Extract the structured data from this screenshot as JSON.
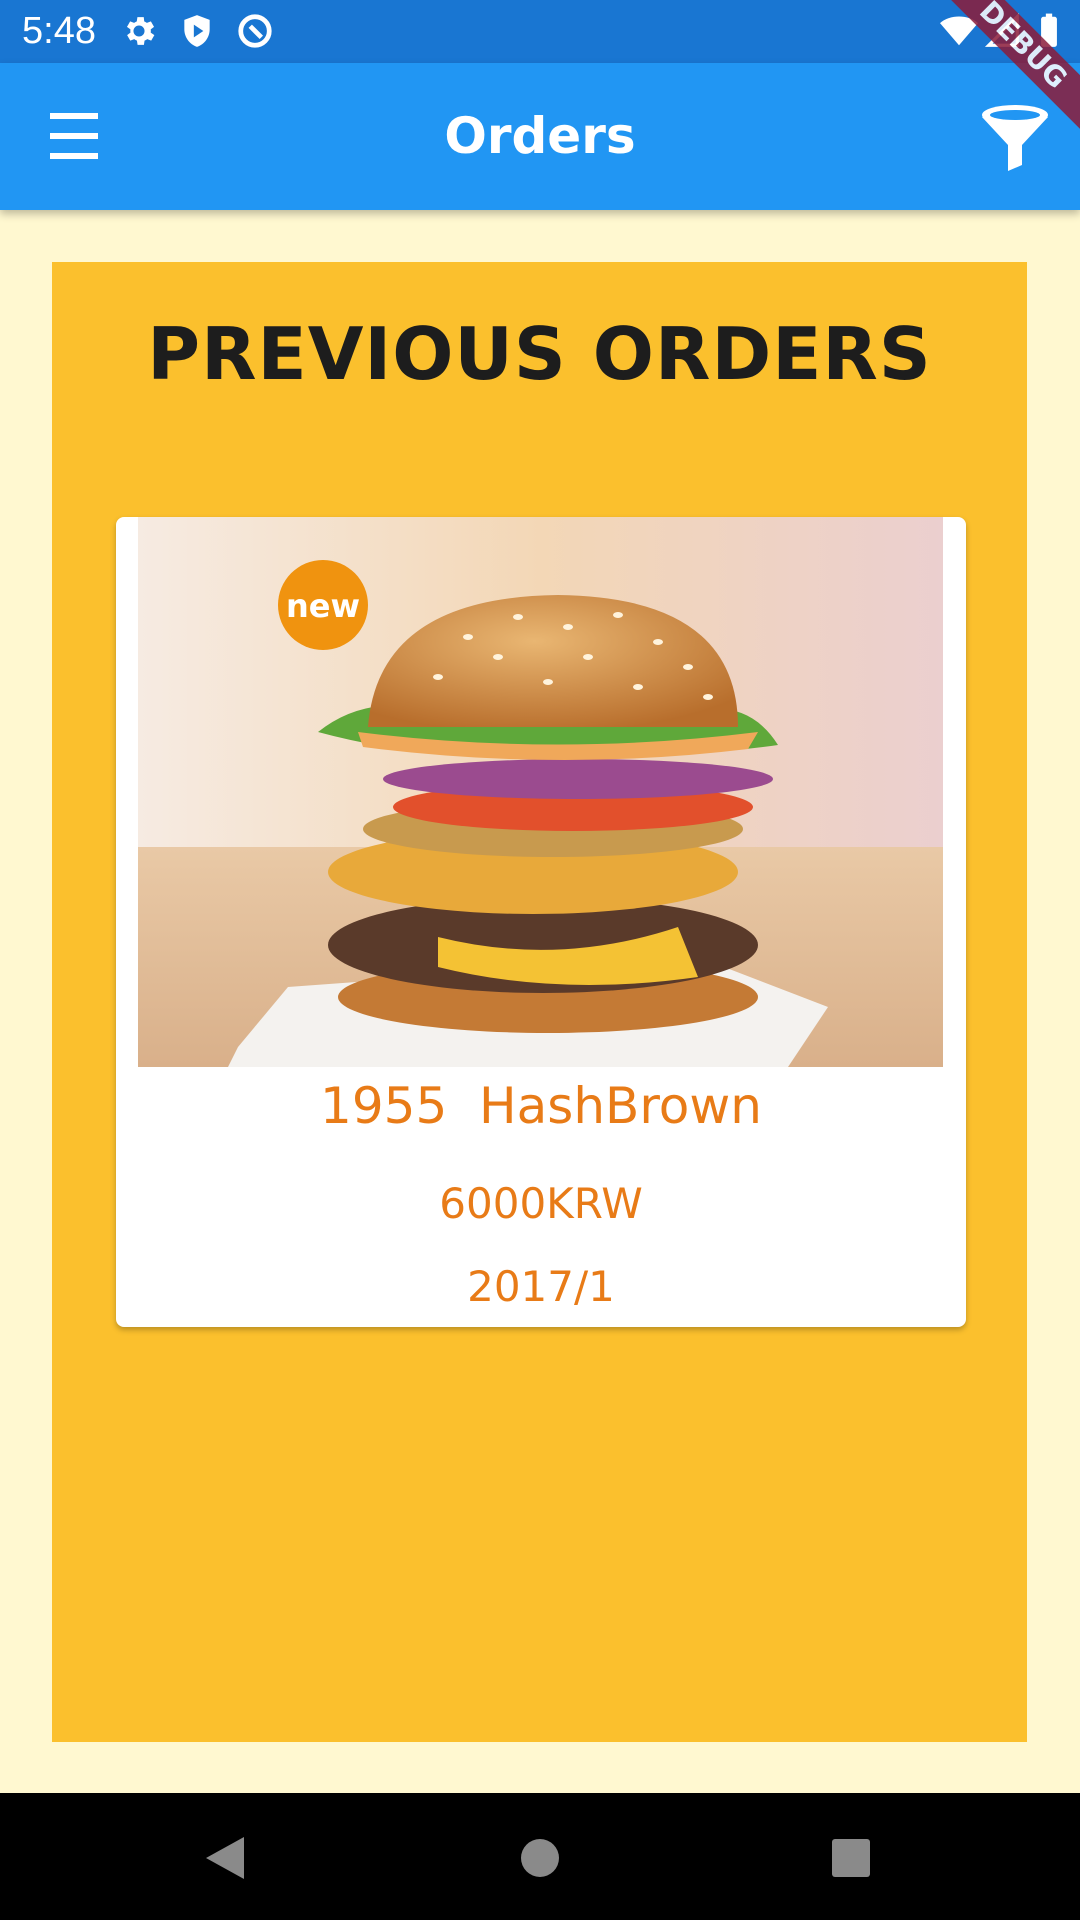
{
  "status_bar": {
    "time": "5:48",
    "icons": [
      "gear-icon",
      "shield-play-icon",
      "circle-badge-icon",
      "wifi-icon",
      "signal-icon",
      "battery-icon"
    ]
  },
  "debug_ribbon": "DEBUG",
  "app_bar": {
    "title": "Orders",
    "menu_icon": "hamburger-menu-icon",
    "filter_icon": "filter-funnel-icon",
    "color": "#2196F3"
  },
  "panel": {
    "title": "PREVIOUS ORDERS",
    "color": "#FBC02D"
  },
  "orders": [
    {
      "image": "burger-photo",
      "badge": "new",
      "name": "1955  HashBrown",
      "price": "6000KRW",
      "date": "2017/1"
    }
  ],
  "nav_bar": {
    "icons": [
      "back-triangle-icon",
      "home-circle-icon",
      "recents-square-icon"
    ]
  },
  "colors": {
    "background": "#FFF8D0",
    "accent_text": "#E87B17"
  }
}
